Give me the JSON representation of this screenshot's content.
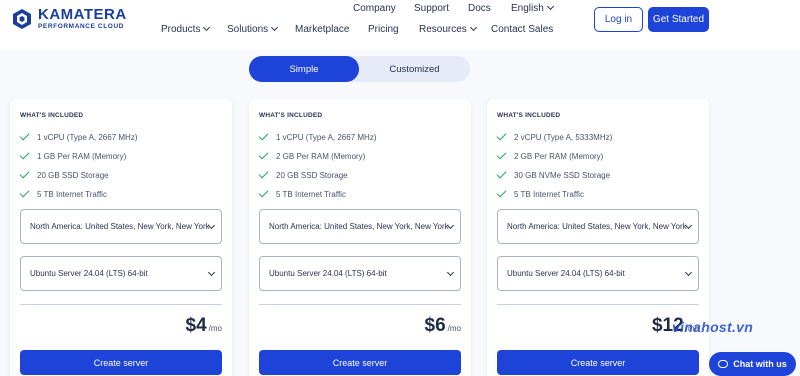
{
  "brand": {
    "name": "KAMATERA",
    "tagline": "PERFORMANCE CLOUD"
  },
  "topnav": [
    "Company",
    "Support",
    "Docs",
    "English"
  ],
  "mainnav": [
    "Products",
    "Solutions",
    "Marketplace",
    "Pricing",
    "Resources",
    "Contact Sales"
  ],
  "auth": {
    "login": "Log in",
    "start": "Get Started"
  },
  "toggle": {
    "simple": "Simple",
    "customized": "Customized"
  },
  "included_label": "WHAT'S INCLUDED",
  "plans": [
    {
      "features": [
        "1 vCPU (Type A, 2667 MHz)",
        "1 GB Per RAM (Memory)",
        "20 GB SSD Storage",
        "5 TB Internet Traffic"
      ],
      "region": "North America: United States, New York, New York",
      "os": "Ubuntu Server 24.04 (LTS) 64-bit",
      "price": "$4",
      "per": "/mo",
      "cta": "Create server"
    },
    {
      "features": [
        "1 vCPU (Type A, 2667 MHz)",
        "2 GB Per RAM (Memory)",
        "20 GB SSD Storage",
        "5 TB Internet Traffic"
      ],
      "region": "North America: United States, New York, New York",
      "os": "Ubuntu Server 24.04 (LTS) 64-bit",
      "price": "$6",
      "per": "/mo",
      "cta": "Create server"
    },
    {
      "features": [
        "2 vCPU (Type A, 5333MHz)",
        "2 GB Per RAM (Memory)",
        "30 GB NVMe SSD Storage",
        "5 TB Internet Traffic"
      ],
      "region": "North America: United States, New York, New York",
      "os": "Ubuntu Server 24.04 (LTS) 64-bit",
      "price": "$12",
      "per": "/mo",
      "cta": "Create server"
    }
  ],
  "watermark": "vinahost.vn",
  "chat": "Chat with us",
  "colors": {
    "primary": "#1d43d8",
    "check": "#22a85a",
    "brand": "#1b3e9f"
  }
}
